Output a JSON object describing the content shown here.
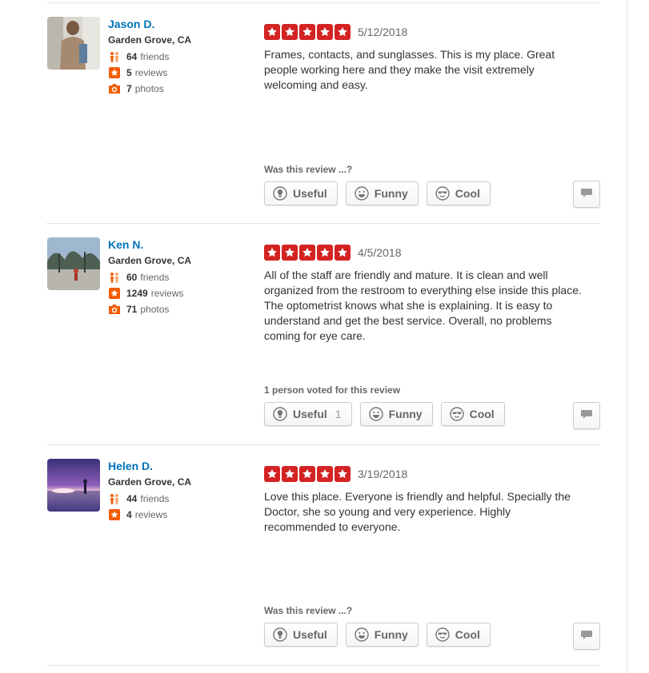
{
  "colors": {
    "star": "#d32323",
    "name": "#0073bb",
    "stat_icon": "#f15c00"
  },
  "reviews": [
    {
      "user": {
        "name": "Jason D.",
        "location": "Garden Grove, CA",
        "friends": "64",
        "friends_label": "friends",
        "reviews": "5",
        "reviews_label": "reviews",
        "photos": "7",
        "photos_label": "photos"
      },
      "rating": 5,
      "date": "5/12/2018",
      "text": "Frames, contacts, and sunglasses. This is my place. Great people working here and they make the visit extremely welcoming and easy.",
      "vote_label": "Was this review ...?",
      "buttons": {
        "useful": "Useful",
        "funny": "Funny",
        "cool": "Cool"
      },
      "useful_count": ""
    },
    {
      "user": {
        "name": "Ken N.",
        "location": "Garden Grove, CA",
        "friends": "60",
        "friends_label": "friends",
        "reviews": "1249",
        "reviews_label": "reviews",
        "photos": "71",
        "photos_label": "photos"
      },
      "rating": 5,
      "date": "4/5/2018",
      "text": "All of the staff are friendly and mature. It is clean and well organized from the restroom to everything else inside this place. The optometrist knows what she is explaining. It is easy to understand and get the best service. Overall, no problems coming for eye care.",
      "vote_label": "1 person voted for this review",
      "buttons": {
        "useful": "Useful",
        "funny": "Funny",
        "cool": "Cool"
      },
      "useful_count": "1"
    },
    {
      "user": {
        "name": "Helen D.",
        "location": "Garden Grove, CA",
        "friends": "44",
        "friends_label": "friends",
        "reviews": "4",
        "reviews_label": "reviews"
      },
      "rating": 5,
      "date": "3/19/2018",
      "text": "Love this place. Everyone is friendly and helpful. Specially the Doctor, she so young and very experience. Highly recommended to everyone.",
      "vote_label": "Was this review ...?",
      "buttons": {
        "useful": "Useful",
        "funny": "Funny",
        "cool": "Cool"
      },
      "useful_count": ""
    }
  ]
}
